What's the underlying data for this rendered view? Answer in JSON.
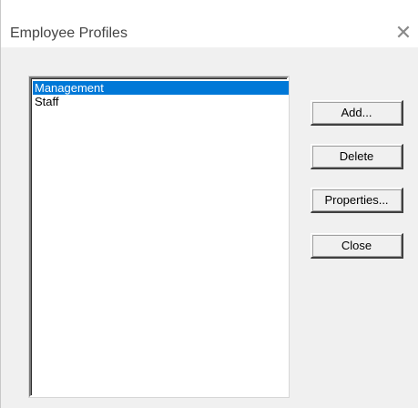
{
  "window": {
    "title": "Employee Profiles",
    "close_glyph": "✕"
  },
  "listbox": {
    "items": [
      {
        "label": "Management",
        "selected": true
      },
      {
        "label": "Staff",
        "selected": false
      }
    ]
  },
  "buttons": {
    "add_label": "Add...",
    "delete_label": "Delete",
    "properties_label": "Properties...",
    "close_label": "Close"
  },
  "colors": {
    "selection": "#0078d7",
    "background": "#f0f0f0"
  }
}
